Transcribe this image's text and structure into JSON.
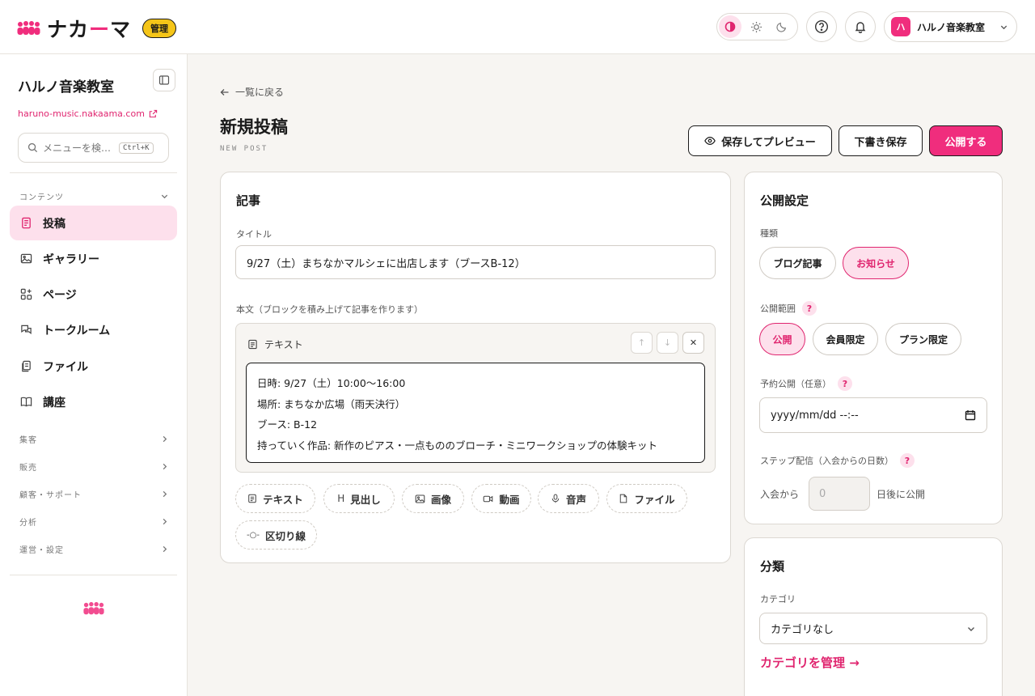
{
  "header": {
    "logo_text_a": "ナカ",
    "logo_text_b": "ー",
    "logo_text_c": "マ",
    "admin_badge": "管理",
    "account_initial": "ハ",
    "account_name": "ハルノ音楽教室"
  },
  "sidebar": {
    "site_name": "ハルノ音楽教室",
    "site_url": "haruno-music.nakaama.com",
    "search_placeholder": "メニューを検…",
    "search_shortcut": "Ctrl+K",
    "content_section": "コンテンツ",
    "items": [
      {
        "label": "投稿",
        "icon": "document-icon"
      },
      {
        "label": "ギャラリー",
        "icon": "image-icon"
      },
      {
        "label": "ページ",
        "icon": "page-add-icon"
      },
      {
        "label": "トークルーム",
        "icon": "chat-icon"
      },
      {
        "label": "ファイル",
        "icon": "file-icon"
      },
      {
        "label": "講座",
        "icon": "book-icon"
      }
    ],
    "sections": [
      "集客",
      "販売",
      "顧客・サポート",
      "分析",
      "運営・設定"
    ]
  },
  "main": {
    "back_label": "一覧に戻る",
    "title": "新規投稿",
    "subtitle": "NEW POST",
    "preview_button": "保存してプレビュー",
    "draft_button": "下書き保存",
    "publish_button": "公開する"
  },
  "article": {
    "heading": "記事",
    "title_label": "タイトル",
    "title_value": "9/27（土）まちなかマルシェに出店します（ブースB-12）",
    "body_label": "本文（ブロックを積み上げて記事を作ります）",
    "block_type": "テキスト",
    "body_lines": [
      "日時: 9/27（土）10:00〜16:00",
      "場所: まちなか広場（雨天決行）",
      "ブース: B-12",
      "持っていく作品: 新作のピアス・一点もののブローチ・ミニワークショップの体験キット"
    ],
    "add_blocks": [
      "テキスト",
      "見出し",
      "画像",
      "動画",
      "音声",
      "ファイル",
      "区切り線"
    ]
  },
  "publish": {
    "heading": "公開設定",
    "kind_label": "種類",
    "kind_options": [
      "ブログ記事",
      "お知らせ"
    ],
    "kind_selected": "お知らせ",
    "scope_label": "公開範囲",
    "scope_options": [
      "公開",
      "会員限定",
      "プラン限定"
    ],
    "scope_selected": "公開",
    "schedule_label": "予約公開（任意）",
    "schedule_placeholder": "yyyy/mm/dd --:--",
    "step_label": "ステップ配信（入会からの日数）",
    "step_prefix": "入会から",
    "step_placeholder": "0",
    "step_suffix": "日後に公開",
    "help_glyph": "?"
  },
  "category": {
    "heading": "分類",
    "label": "カテゴリ",
    "selected": "カテゴリなし",
    "manage_link": "カテゴリを管理 →"
  },
  "colors": {
    "accent": "#f02d7d",
    "accent_soft": "#fde0ec",
    "badge": "#f5c518"
  }
}
